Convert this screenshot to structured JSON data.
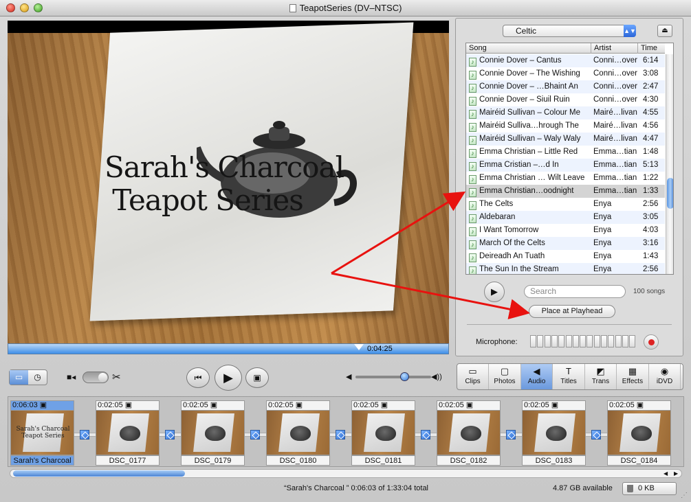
{
  "window": {
    "title": "TeapotSeries (DV–NTSC)"
  },
  "viewer": {
    "title_line1": "Sarah's Charcoal",
    "title_line2": "Teapot Series",
    "playhead_time": "0:04:25"
  },
  "audio_pane": {
    "source": "Celtic",
    "columns": {
      "song": "Song",
      "artist": "Artist",
      "time": "Time"
    },
    "songs": [
      {
        "song": "Connie Dover – Cantus",
        "artist": "Conni…over",
        "time": "6:14"
      },
      {
        "song": "Connie Dover – The Wishing",
        "artist": "Conni…over",
        "time": "3:08"
      },
      {
        "song": "Connie Dover – …Bhaint An",
        "artist": "Conni…over",
        "time": "2:47"
      },
      {
        "song": "Connie Dover – Siuil Ruin",
        "artist": "Conni…over",
        "time": "4:30"
      },
      {
        "song": "Mairéid Sullivan – Colour Me",
        "artist": "Mairé…livan",
        "time": "4:55"
      },
      {
        "song": "Mairéid Sulliva…hrough The",
        "artist": "Mairé…livan",
        "time": "4:56"
      },
      {
        "song": "Mairéid Sullivan – Waly Waly",
        "artist": "Mairé…livan",
        "time": "4:47"
      },
      {
        "song": "Emma Christian – Little Red",
        "artist": "Emma…tian",
        "time": "1:48"
      },
      {
        "song": "Emma Cristian –…d In",
        "artist": "Emma…tian",
        "time": "5:13"
      },
      {
        "song": "Emma Christian … Wilt Leave",
        "artist": "Emma…tian",
        "time": "1:22"
      },
      {
        "song": "Emma Christian…oodnight",
        "artist": "Emma…tian",
        "time": "1:33",
        "selected": true
      },
      {
        "song": "The Celts",
        "artist": "Enya",
        "time": "2:56"
      },
      {
        "song": "Aldebaran",
        "artist": "Enya",
        "time": "3:05"
      },
      {
        "song": "I Want Tomorrow",
        "artist": "Enya",
        "time": "4:03"
      },
      {
        "song": "March Of the Celts",
        "artist": "Enya",
        "time": "3:16"
      },
      {
        "song": "Deireadh An Tuath",
        "artist": "Enya",
        "time": "1:43"
      },
      {
        "song": "The Sun In the Stream",
        "artist": "Enya",
        "time": "2:56"
      }
    ],
    "search_placeholder": "Search",
    "song_count": "100 songs",
    "place_button": "Place at Playhead",
    "microphone_label": "Microphone:"
  },
  "pane_buttons": [
    {
      "label": "Clips",
      "icon": "clips-icon"
    },
    {
      "label": "Photos",
      "icon": "photos-icon"
    },
    {
      "label": "Audio",
      "icon": "audio-icon",
      "active": true
    },
    {
      "label": "Titles",
      "icon": "titles-icon"
    },
    {
      "label": "Trans",
      "icon": "transitions-icon"
    },
    {
      "label": "Effects",
      "icon": "effects-icon"
    },
    {
      "label": "iDVD",
      "icon": "idvd-icon"
    }
  ],
  "clips": [
    {
      "duration": "0:06:03",
      "name": "Sarah's Charcoal",
      "selected": true,
      "thumb_text": "Sarah's Charcoal Teapot Series"
    },
    {
      "duration": "0:02:05",
      "name": "DSC_0177"
    },
    {
      "duration": "0:02:05",
      "name": "DSC_0179"
    },
    {
      "duration": "0:02:05",
      "name": "DSC_0180"
    },
    {
      "duration": "0:02:05",
      "name": "DSC_0181"
    },
    {
      "duration": "0:02:05",
      "name": "DSC_0182"
    },
    {
      "duration": "0:02:05",
      "name": "DSC_0183"
    },
    {
      "duration": "0:02:05",
      "name": "DSC_0184"
    }
  ],
  "status": {
    "selection": "“Sarah's Charcoal ” 0:06:03 of 1:33:04 total",
    "disk_available": "4.87 GB available",
    "trash_size": "0 KB"
  },
  "colors": {
    "accent": "#3e8ee8",
    "annotation_arrow": "#e8120f",
    "record": "#d22222"
  }
}
